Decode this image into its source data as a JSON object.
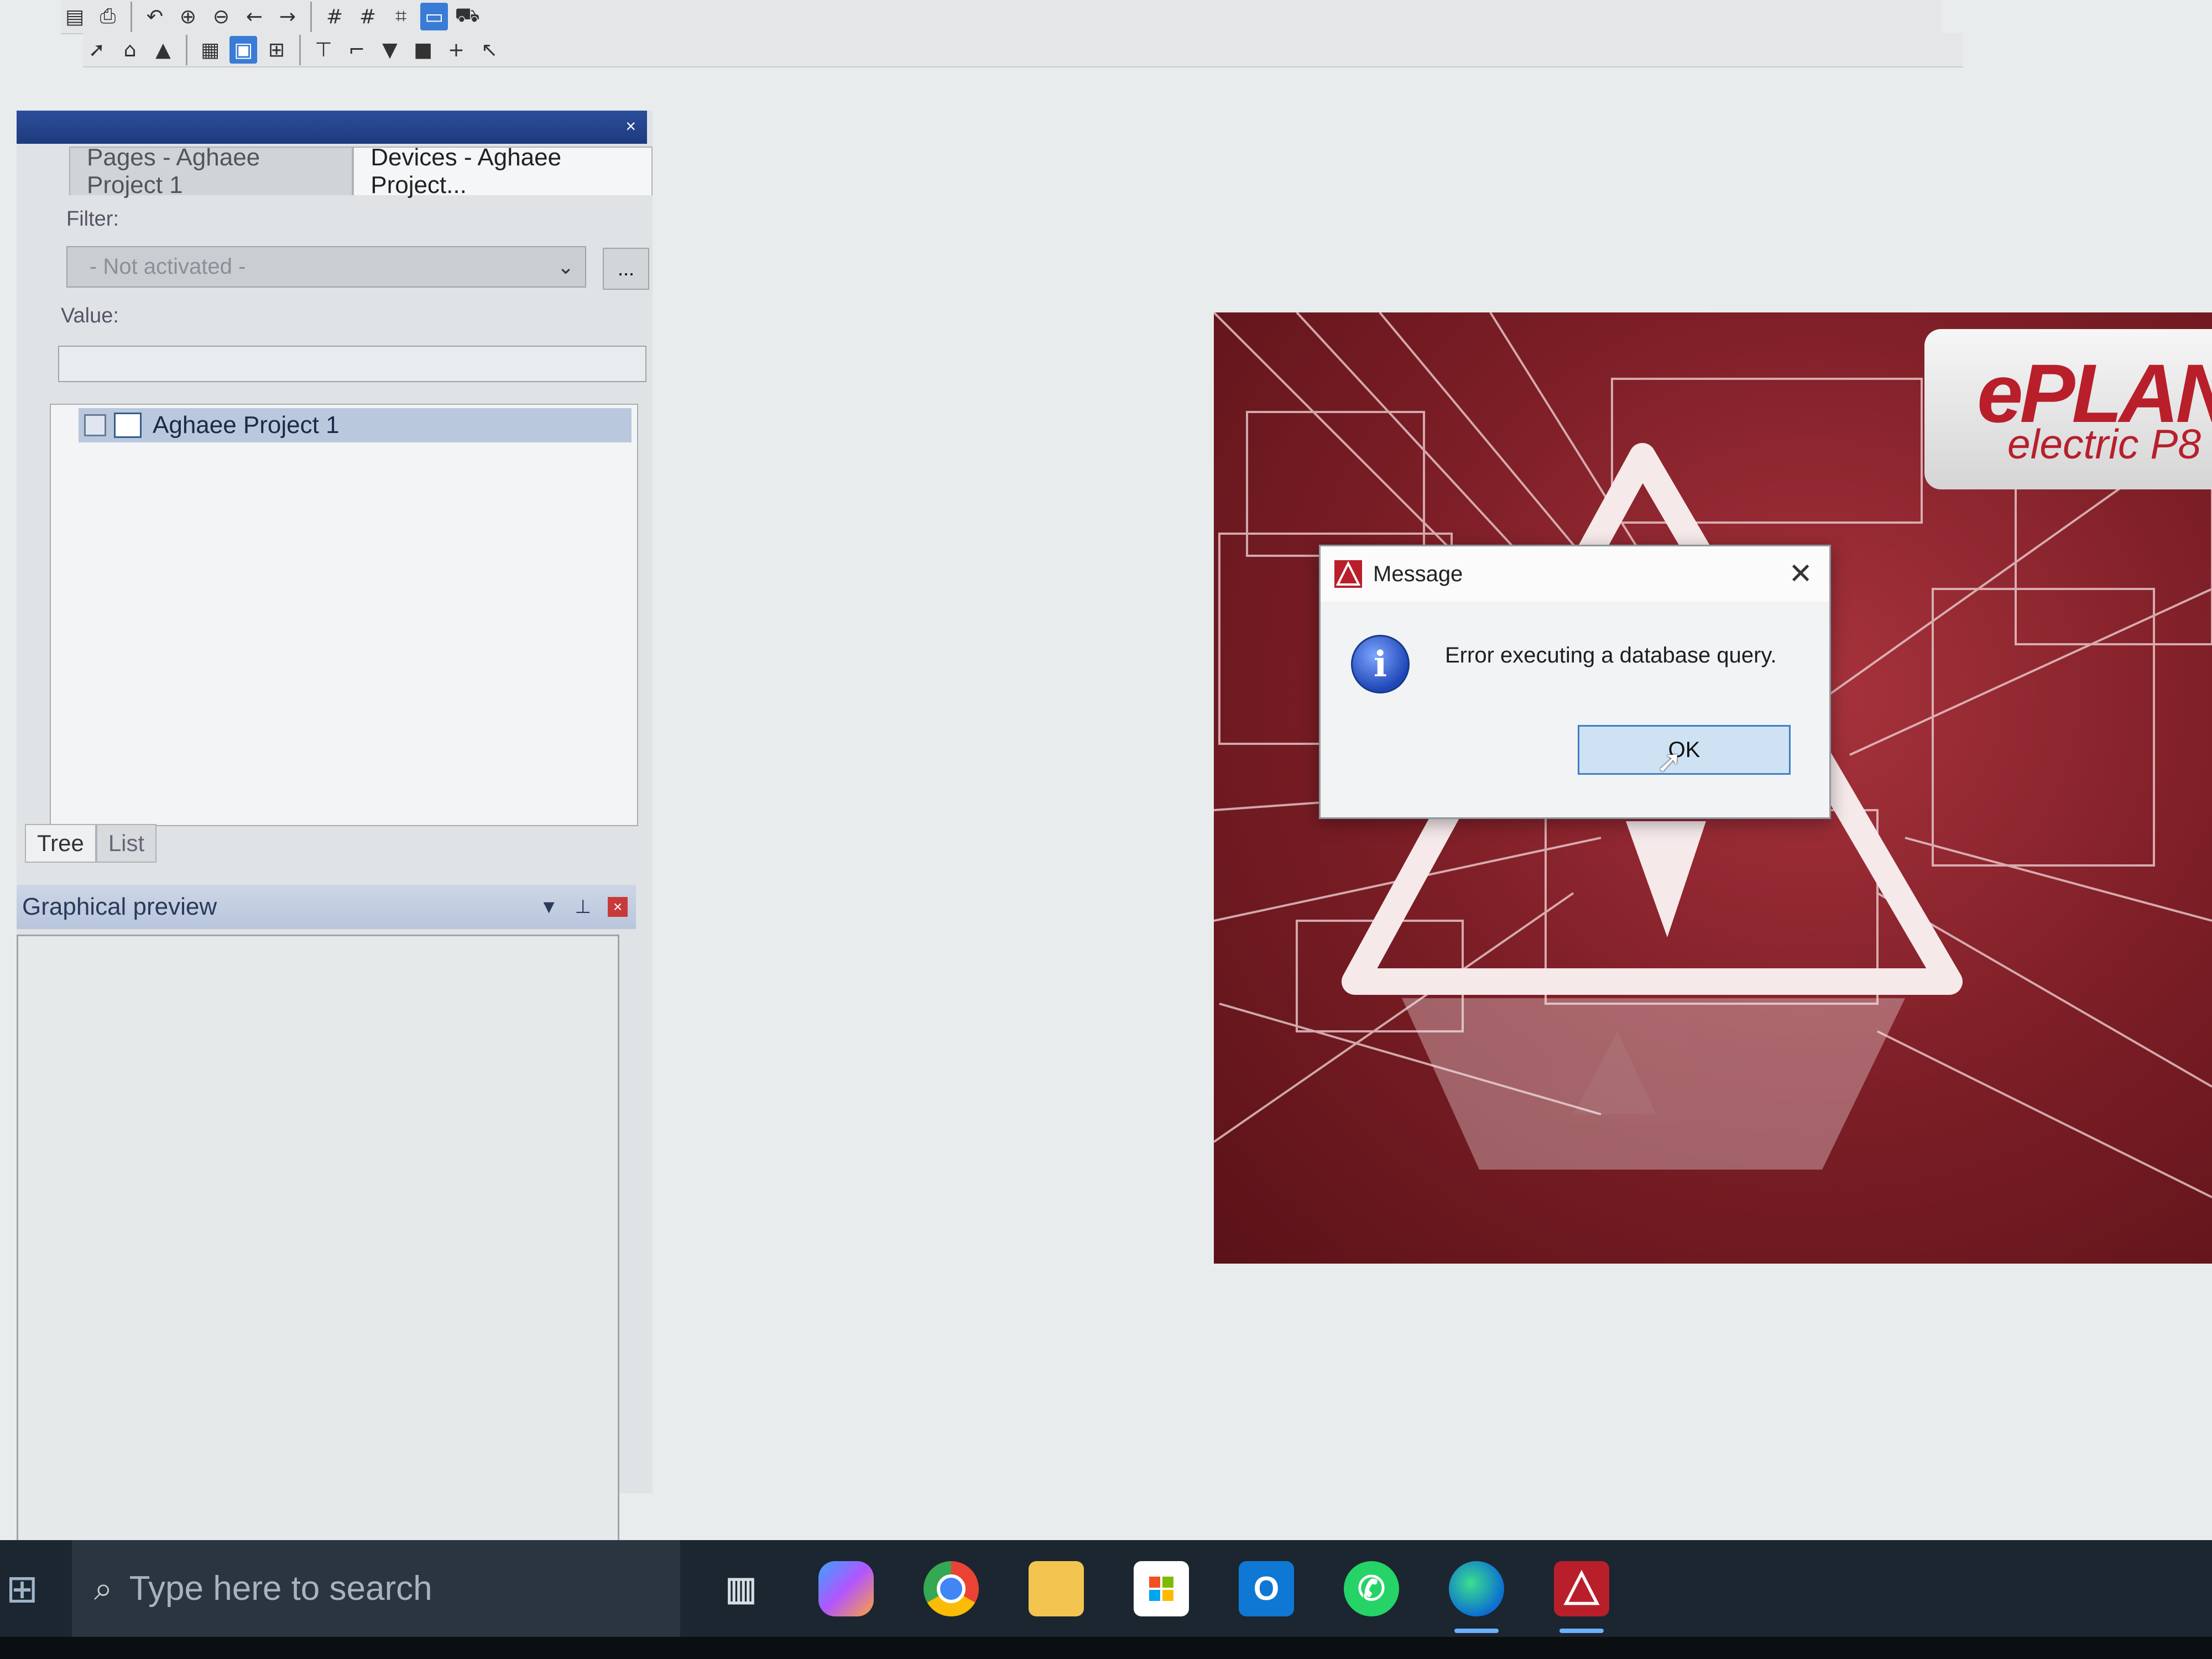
{
  "panel": {
    "tabs": [
      {
        "label": "Pages - Aghaee Project 1"
      },
      {
        "label": "Devices - Aghaee Project..."
      }
    ],
    "filter_label": "Filter:",
    "filter_value": "- Not activated -",
    "filter_more": "...",
    "value_label": "Value:",
    "value_input": "",
    "tree_item": "Aghaee Project 1",
    "bottom_tabs": [
      {
        "label": "Tree"
      },
      {
        "label": "List"
      }
    ],
    "close": "×"
  },
  "preview": {
    "title": "Graphical preview"
  },
  "splash": {
    "logo_main": "ePLAN",
    "logo_sub": "electric P8"
  },
  "dialog": {
    "title": "Message",
    "message": "Error executing a database query.",
    "ok_label": "OK",
    "icon": "info-icon"
  },
  "taskbar": {
    "search_placeholder": "Type here to search",
    "apps": [
      "task-view",
      "copilot",
      "chrome",
      "file-explorer",
      "microsoft-store",
      "outlook",
      "whatsapp",
      "edge",
      "eplan"
    ]
  },
  "colors": {
    "accent": "#3d7fc6",
    "brand": "#b81f2b",
    "taskbar": "#1b2630"
  }
}
